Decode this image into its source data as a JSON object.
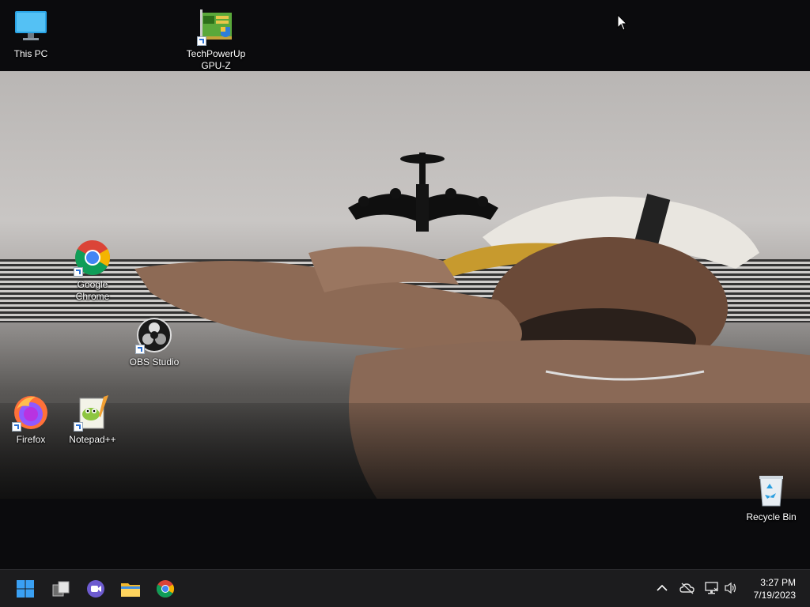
{
  "desktop": {
    "icons": [
      {
        "name": "This PC"
      },
      {
        "name": "TechPowerUp\nGPU-Z"
      },
      {
        "name": "Google\nChrome"
      },
      {
        "name": "OBS Studio"
      },
      {
        "name": "Firefox"
      },
      {
        "name": "Notepad++"
      },
      {
        "name": "Recycle Bin"
      }
    ]
  },
  "taskbar": {
    "pinned": [
      "start-icon",
      "task-view-icon",
      "meet-chat-icon",
      "file-explorer-icon",
      "chrome-icon"
    ],
    "tray": [
      "chevron-up-icon",
      "cloud-offline-icon",
      "network-icon",
      "volume-icon"
    ],
    "clock": {
      "time": "3:27 PM",
      "date": "7/19/2023"
    }
  },
  "colors": {
    "taskbar_bg": "#1c1c1e",
    "desktop_bg": "#0b0b0d",
    "start_blue": "#3aa0f3"
  }
}
